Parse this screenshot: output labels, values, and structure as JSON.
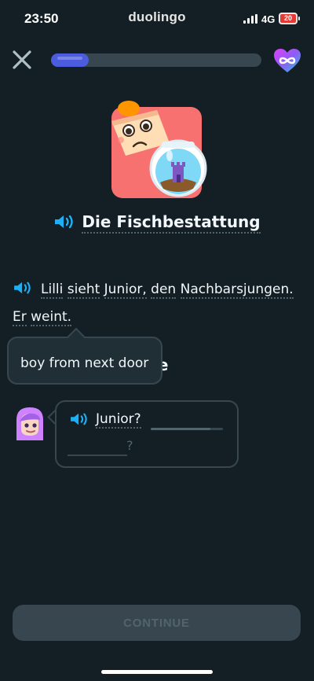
{
  "status_bar": {
    "time": "23:50",
    "app_name": "duolingo",
    "network": "4G",
    "battery": "20"
  },
  "top_bar": {
    "close_icon": "close-icon",
    "lesson_progress": 0.18,
    "hearts_icon": "infinite-hearts-icon"
  },
  "story": {
    "illustration": "crying-boy-with-fishbowl",
    "title": "Die Fischbestattung",
    "sentence_words": [
      "Lilli",
      "sieht",
      "Junior,",
      "den",
      "Nachbarsjungen.",
      "Er",
      "weint."
    ]
  },
  "task": {
    "heading_visible": "hrase"
  },
  "tooltip": {
    "text": "boy from next door"
  },
  "dialogue": {
    "speaker_avatar": "purple-haired-girl-avatar",
    "word": "Junior?",
    "question_mark": "?"
  },
  "footer": {
    "continue_label": "CONTINUE"
  },
  "colors": {
    "background": "#131f24",
    "progress": "#4b5cde",
    "speaker_blue": "#1cb0f6",
    "disabled_button": "#37464f"
  }
}
